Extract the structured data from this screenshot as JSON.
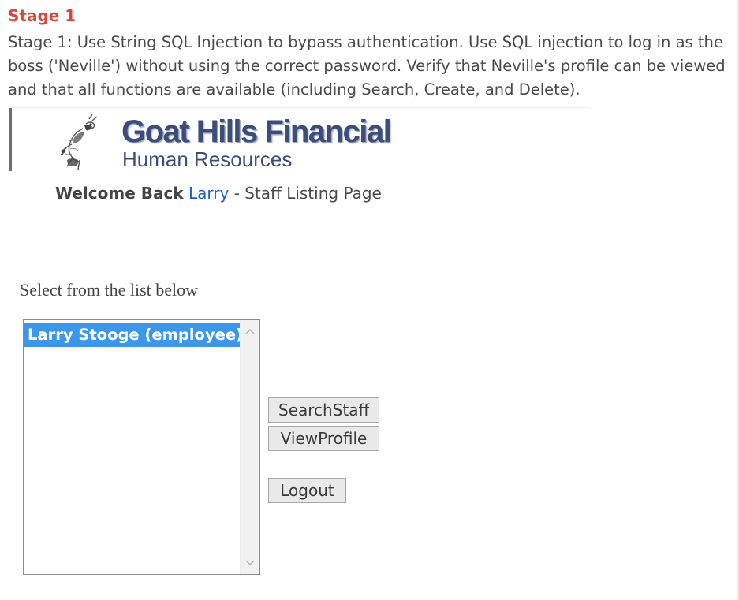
{
  "stage": {
    "title": "Stage 1",
    "description": "Stage 1: Use String SQL Injection to bypass authentication. Use SQL injection to log in as the boss ('Neville') without using the correct password. Verify that Neville's profile can be viewed and that all functions are available (including Search, Create, and Delete)."
  },
  "banner": {
    "company": "Goat Hills Financial",
    "department": "Human Resources",
    "logo_icon": "goat-logo-icon"
  },
  "welcome": {
    "prefix": "Welcome Back",
    "user": "Larry",
    "suffix": "- Staff Listing Page"
  },
  "staff_list": {
    "label": "Select from the list below",
    "options": [
      "Larry Stooge (employee)"
    ],
    "selected": "Larry Stooge (employee)"
  },
  "buttons": {
    "search_staff": "SearchStaff",
    "view_profile": "ViewProfile",
    "logout": "Logout"
  },
  "colors": {
    "stage_title": "#d9463a",
    "link": "#1f5fc2",
    "selection": "#3c97ea",
    "banner_text": "#3d4d7a"
  }
}
